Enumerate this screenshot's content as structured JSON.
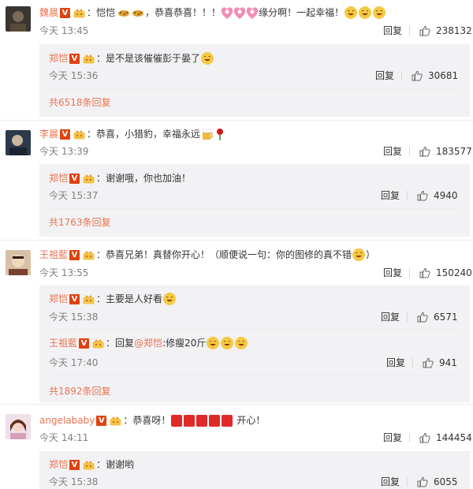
{
  "comments": [
    {
      "user": "魏晨",
      "sep": "：",
      "text_a": "恺恺",
      "text_b": "，恭喜恭喜！！！",
      "text_c": "缘分啊！一起幸福！",
      "time": "今天 13:45",
      "reply": "回复",
      "likes": "238132",
      "reply_item": {
        "user": "郑恺",
        "sep": "：",
        "text": "是不是该催催彭于晏了",
        "time": "今天 15:36",
        "reply": "回复",
        "likes": "30681"
      },
      "more": "共6518条回复"
    },
    {
      "user": "李晨",
      "sep": "：",
      "text": "恭喜，小猎豹，幸福永远",
      "time": "今天 13:39",
      "reply": "回复",
      "likes": "183577",
      "reply_item": {
        "user": "郑恺",
        "sep": "：",
        "text": "谢谢哦，你也加油！",
        "time": "今天 15:37",
        "reply": "回复",
        "likes": "4940"
      },
      "more": "共1763条回复"
    },
    {
      "user": "王祖藍",
      "sep": "：",
      "text": "恭喜兄弟！真替你开心！（顺便说一句：你的图修的真不错",
      "text_end": "）",
      "time": "今天 13:55",
      "reply": "回复",
      "likes": "150240",
      "reply_item": {
        "user": "郑恺",
        "sep": "：",
        "text": "主要是人好看",
        "time": "今天 15:38",
        "reply": "回复",
        "likes": "6571"
      },
      "reply_item2": {
        "user": "王祖藍",
        "sep": "：",
        "text_a": "回复",
        "mention": "@郑恺",
        "text_b": ":修瘦20斤",
        "time": "今天 17:40",
        "reply": "回复",
        "likes": "941"
      },
      "more": "共1892条回复"
    },
    {
      "user": "angelababy",
      "sep": "：",
      "text_a": "恭喜呀！",
      "text_b": "开心！",
      "time": "今天 14:11",
      "reply": "回复",
      "likes": "144454",
      "reply_item": {
        "user": "郑恺",
        "sep": "：",
        "text": "谢谢哟",
        "time": "今天 15:38",
        "reply": "回复",
        "likes": "6055"
      }
    }
  ],
  "badge_letter": "V",
  "colors": {
    "username": "#eb7350",
    "badge": "#e0420f",
    "subbox_bg": "#f2f2f5",
    "meta": "#808080"
  },
  "icons": [
    "verified-badge-icon",
    "crown-icon",
    "thumb-up-icon",
    "emoji-icon"
  ]
}
